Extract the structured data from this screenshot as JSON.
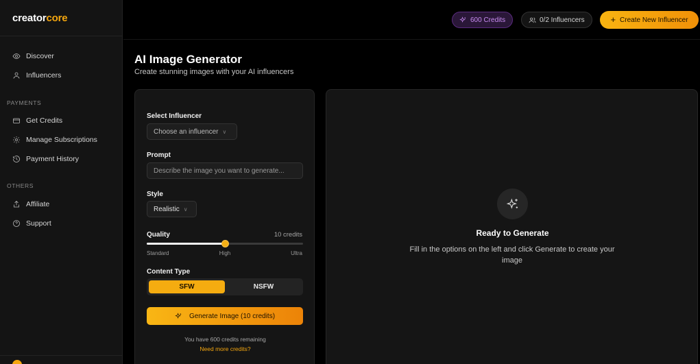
{
  "brand": {
    "part1": "creator",
    "part2": "core"
  },
  "sidebar": {
    "main_items": [
      {
        "label": "Discover",
        "icon": "eye-icon"
      },
      {
        "label": "Influencers",
        "icon": "user-icon"
      }
    ],
    "payments_label": "PAYMENTS",
    "payments_items": [
      {
        "label": "Get Credits",
        "icon": "credit-card-icon"
      },
      {
        "label": "Manage Subscriptions",
        "icon": "gear-icon"
      },
      {
        "label": "Payment History",
        "icon": "history-icon"
      }
    ],
    "others_label": "OTHERS",
    "others_items": [
      {
        "label": "Affiliate",
        "icon": "share-icon"
      },
      {
        "label": "Support",
        "icon": "help-circle-icon"
      }
    ]
  },
  "topbar": {
    "credits": "600 Credits",
    "influencers": "0/2 Influencers",
    "create_button": "Create New Influencer",
    "create_button_icon": "plus-icon"
  },
  "page": {
    "title": "AI Image Generator",
    "subtitle": "Create stunning images with your AI influencers"
  },
  "form": {
    "influencer_label": "Select Influencer",
    "influencer_value": "Choose an influencer",
    "prompt_label": "Prompt",
    "prompt_placeholder": "Describe the image you want to generate...",
    "prompt_value": "",
    "style_label": "Style",
    "style_value": "Realistic",
    "quality_label": "Quality",
    "quality_credits": "10 credits",
    "quality_level": 0.5,
    "quality_ticks": [
      "Standard",
      "High",
      "Ultra"
    ],
    "content_type_label": "Content Type",
    "content_options": [
      "SFW",
      "NSFW"
    ],
    "content_selected": "SFW",
    "generate_button": "Generate Image (10 credits)",
    "remaining_text": "You have 600 credits remaining",
    "need_more_link": "Need more credits?"
  },
  "preview": {
    "icon": "sparkles-icon",
    "title": "Ready to Generate",
    "text": "Fill in the options on the left and click Generate to create your image"
  },
  "colors": {
    "accent": "#f5a70f",
    "credits_pill": "#c98cf2",
    "background": "#000000",
    "card": "#151515"
  }
}
